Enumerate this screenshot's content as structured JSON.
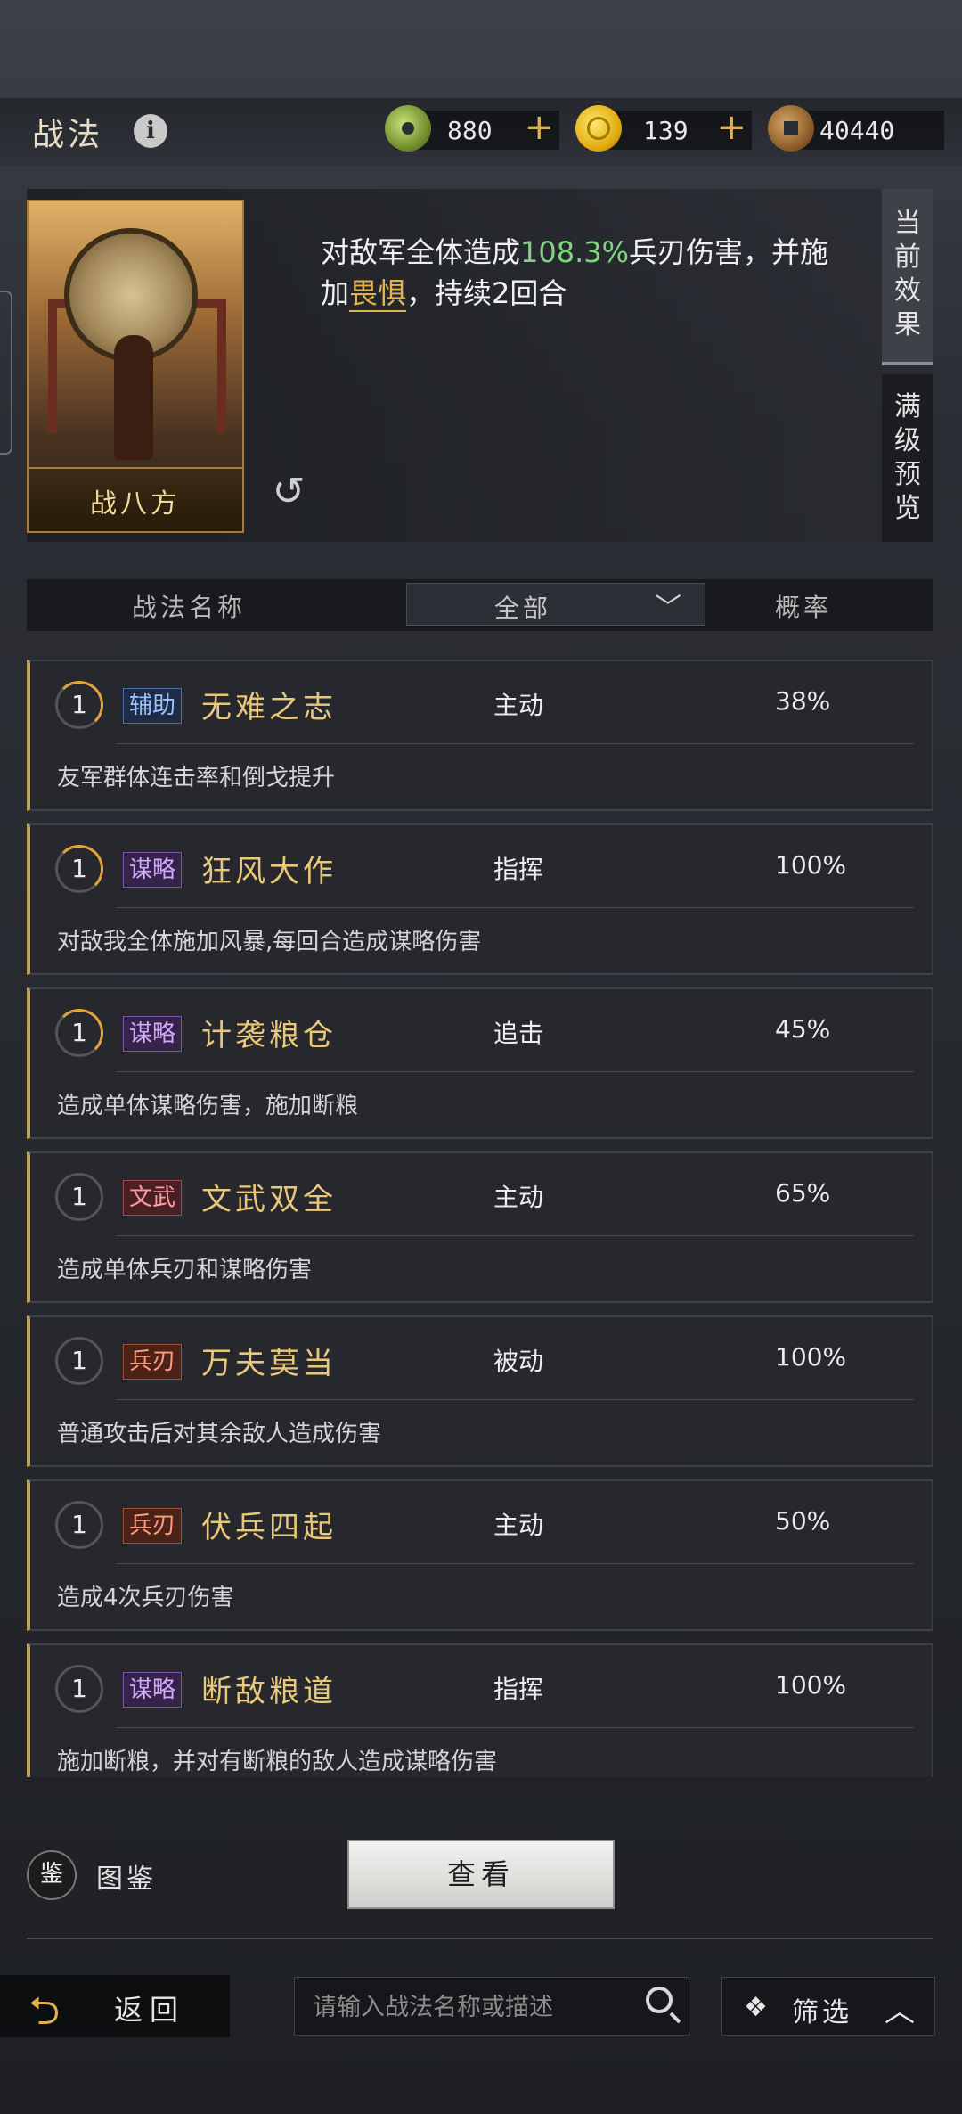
{
  "header": {
    "title": "战法",
    "currencies": [
      {
        "icon": "jade-coin-icon",
        "value": "880",
        "plus": "+"
      },
      {
        "icon": "gold-coin-icon",
        "value": "139",
        "plus": "+"
      },
      {
        "icon": "copper-coin-icon",
        "value": "40440"
      }
    ]
  },
  "card": {
    "name": "战八方"
  },
  "effect": {
    "p1": "对敌军全体造成",
    "highlight": "108.3%",
    "p2": "兵刃伤害，并施加",
    "status": "畏惧",
    "p3": "，持续2回合"
  },
  "side_tabs": [
    "当前效果",
    "满级预览"
  ],
  "filter": {
    "col_name": "战法名称",
    "dropdown": "全部",
    "col_rate": "概率"
  },
  "skills": [
    {
      "level": "1",
      "tag": "辅助",
      "tag_class": "assist",
      "name": "无难之志",
      "type": "主动",
      "rate": "38%",
      "desc": "友军群体连击率和倒戈提升"
    },
    {
      "level": "1",
      "tag": "谋略",
      "tag_class": "strategy",
      "name": "狂风大作",
      "type": "指挥",
      "rate": "100%",
      "desc": "对敌我全体施加风暴,每回合造成谋略伤害"
    },
    {
      "level": "1",
      "tag": "谋略",
      "tag_class": "strategy",
      "name": "计袭粮仓",
      "type": "追击",
      "rate": "45%",
      "desc": "造成单体谋略伤害，施加断粮"
    },
    {
      "level": "1",
      "tag": "文武",
      "tag_class": "civil",
      "name": "文武双全",
      "type": "主动",
      "rate": "65%",
      "desc": "造成单体兵刃和谋略伤害"
    },
    {
      "level": "1",
      "tag": "兵刃",
      "tag_class": "blade",
      "name": "万夫莫当",
      "type": "被动",
      "rate": "100%",
      "desc": "普通攻击后对其余敌人造成伤害"
    },
    {
      "level": "1",
      "tag": "兵刃",
      "tag_class": "blade",
      "name": "伏兵四起",
      "type": "主动",
      "rate": "50%",
      "desc": "造成4次兵刃伤害"
    },
    {
      "level": "1",
      "tag": "谋略",
      "tag_class": "strategy",
      "name": "断敌粮道",
      "type": "指挥",
      "rate": "100%",
      "desc": "施加断粮，并对有断粮的敌人造成谋略伤害"
    }
  ],
  "footer": {
    "codex_icon": "鉴",
    "codex_label": "图鉴",
    "view_button": "查看",
    "back_label": "返回",
    "search_placeholder": "请输入战法名称或描述",
    "filter_label": "筛选"
  }
}
